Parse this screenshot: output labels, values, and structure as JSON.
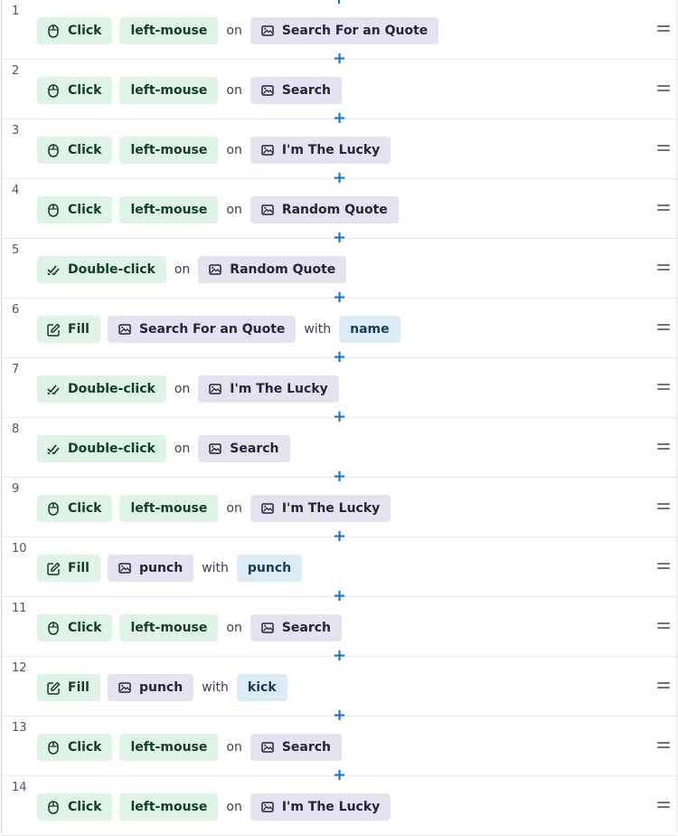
{
  "steps": [
    {
      "n": "1",
      "action": "Click",
      "icon": "mouse-icon",
      "arg": "left-mouse",
      "prep": "on",
      "target": "Search For an Quote"
    },
    {
      "n": "2",
      "action": "Click",
      "icon": "mouse-icon",
      "arg": "left-mouse",
      "prep": "on",
      "target": "Search"
    },
    {
      "n": "3",
      "action": "Click",
      "icon": "mouse-icon",
      "arg": "left-mouse",
      "prep": "on",
      "target": "I'm The Lucky"
    },
    {
      "n": "4",
      "action": "Click",
      "icon": "mouse-icon",
      "arg": "left-mouse",
      "prep": "on",
      "target": "Random Quote"
    },
    {
      "n": "5",
      "action": "Double-click",
      "icon": "double-check-icon",
      "prep": "on",
      "target": "Random Quote"
    },
    {
      "n": "6",
      "action": "Fill",
      "icon": "edit-icon",
      "target": "Search For an Quote",
      "prep": "with",
      "value": "name"
    },
    {
      "n": "7",
      "action": "Double-click",
      "icon": "double-check-icon",
      "prep": "on",
      "target": "I'm The Lucky"
    },
    {
      "n": "8",
      "action": "Double-click",
      "icon": "double-check-icon",
      "prep": "on",
      "target": "Search"
    },
    {
      "n": "9",
      "action": "Click",
      "icon": "mouse-icon",
      "arg": "left-mouse",
      "prep": "on",
      "target": "I'm The Lucky"
    },
    {
      "n": "10",
      "action": "Fill",
      "icon": "edit-icon",
      "target": "punch",
      "prep": "with",
      "value": "punch"
    },
    {
      "n": "11",
      "action": "Click",
      "icon": "mouse-icon",
      "arg": "left-mouse",
      "prep": "on",
      "target": "Search"
    },
    {
      "n": "12",
      "action": "Fill",
      "icon": "edit-icon",
      "target": "punch",
      "prep": "with",
      "value": "kick"
    },
    {
      "n": "13",
      "action": "Click",
      "icon": "mouse-icon",
      "arg": "left-mouse",
      "prep": "on",
      "target": "Search"
    },
    {
      "n": "14",
      "action": "Click",
      "icon": "mouse-icon",
      "arg": "left-mouse",
      "prep": "on",
      "target": "I'm The Lucky"
    }
  ],
  "add_step_glyph": "+",
  "colors": {
    "action_bg": "#dff3e6",
    "target_bg": "#e5e3ef",
    "value_bg": "#dcecf7",
    "accent": "#1473c8"
  }
}
